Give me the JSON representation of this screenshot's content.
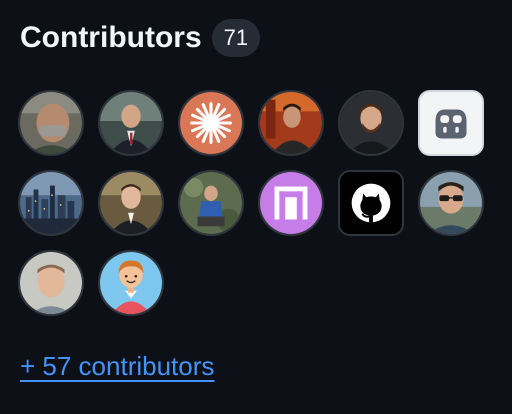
{
  "header": {
    "title": "Contributors",
    "count": "71"
  },
  "contributors": [
    {
      "kind": "photo",
      "icon": "contributor-avatar-1"
    },
    {
      "kind": "photo",
      "icon": "contributor-avatar-2"
    },
    {
      "kind": "logo",
      "icon": "starburst-logo-icon"
    },
    {
      "kind": "photo",
      "icon": "contributor-avatar-4"
    },
    {
      "kind": "photo",
      "icon": "contributor-avatar-5"
    },
    {
      "kind": "logo",
      "icon": "copilot-logo-icon"
    },
    {
      "kind": "photo",
      "icon": "city-skyline-avatar"
    },
    {
      "kind": "photo",
      "icon": "contributor-avatar-8"
    },
    {
      "kind": "photo",
      "icon": "contributor-avatar-9"
    },
    {
      "kind": "logo",
      "icon": "n-logo-icon"
    },
    {
      "kind": "logo",
      "icon": "github-logo-icon"
    },
    {
      "kind": "photo",
      "icon": "contributor-avatar-12"
    },
    {
      "kind": "photo",
      "icon": "contributor-avatar-13"
    },
    {
      "kind": "illustration",
      "icon": "cartoon-person-avatar"
    }
  ],
  "more_link": {
    "label": "+ 57 contributors"
  },
  "colors": {
    "background": "#0d1117",
    "link": "#4493f8",
    "badge": "#262c36",
    "starburst_orange": "#d97757",
    "n_logo_purple": "#c77de8"
  }
}
